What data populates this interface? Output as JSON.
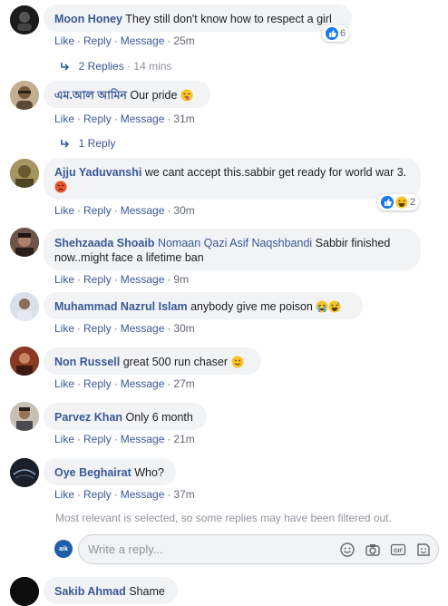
{
  "comments": [
    {
      "name": "Moon Honey",
      "text": "They still don't know how to respect a girl",
      "like": "Like",
      "reply": "Reply",
      "message": "Message",
      "time": "25m",
      "reactions": "6"
    },
    {
      "name": "এম.আল আমিন",
      "text": "Our pride",
      "like": "Like",
      "reply": "Reply",
      "message": "Message",
      "time": "31m"
    },
    {
      "name": "Ajju Yaduvanshi",
      "text": "we cant accept this.sabbir get ready for world war 3.",
      "like": "Like",
      "reply": "Reply",
      "message": "Message",
      "time": "30m",
      "reactions": "2"
    },
    {
      "name": "Shehzaada Shoaib",
      "mention": "Nomaan Qazi Asif Naqshbandi",
      "text": "Sabbir finished now..might face a lifetime ban",
      "like": "Like",
      "reply": "Reply",
      "message": "Message",
      "time": "9m"
    },
    {
      "name": "Muhammad Nazrul Islam",
      "text": "anybody give me poison",
      "like": "Like",
      "reply": "Reply",
      "message": "Message",
      "time": "30m"
    },
    {
      "name": "Non Russell",
      "text": "great 500 run chaser",
      "like": "Like",
      "reply": "Reply",
      "message": "Message",
      "time": "27m"
    },
    {
      "name": "Parvez Khan",
      "text": "Only 6 month",
      "like": "Like",
      "reply": "Reply",
      "message": "Message",
      "time": "21m"
    },
    {
      "name": "Oye Beghairat",
      "text": "Who?",
      "like": "Like",
      "reply": "Reply",
      "message": "Message",
      "time": "37m"
    },
    {
      "name": "Sakib Ahmad",
      "text": "Shame"
    }
  ],
  "reply_toggles": [
    {
      "label": "2 Replies",
      "time": "14 mins"
    },
    {
      "label": "1 Reply"
    }
  ],
  "filter_note": "Most relevant is selected, so some replies may have been filtered out.",
  "composer": {
    "placeholder": "Write a reply...",
    "avatar_text": "aik"
  },
  "colors": {
    "link": "#385898",
    "bubble": "#f2f3f5",
    "meta": "#606770",
    "like_blue": "#1877f2"
  }
}
